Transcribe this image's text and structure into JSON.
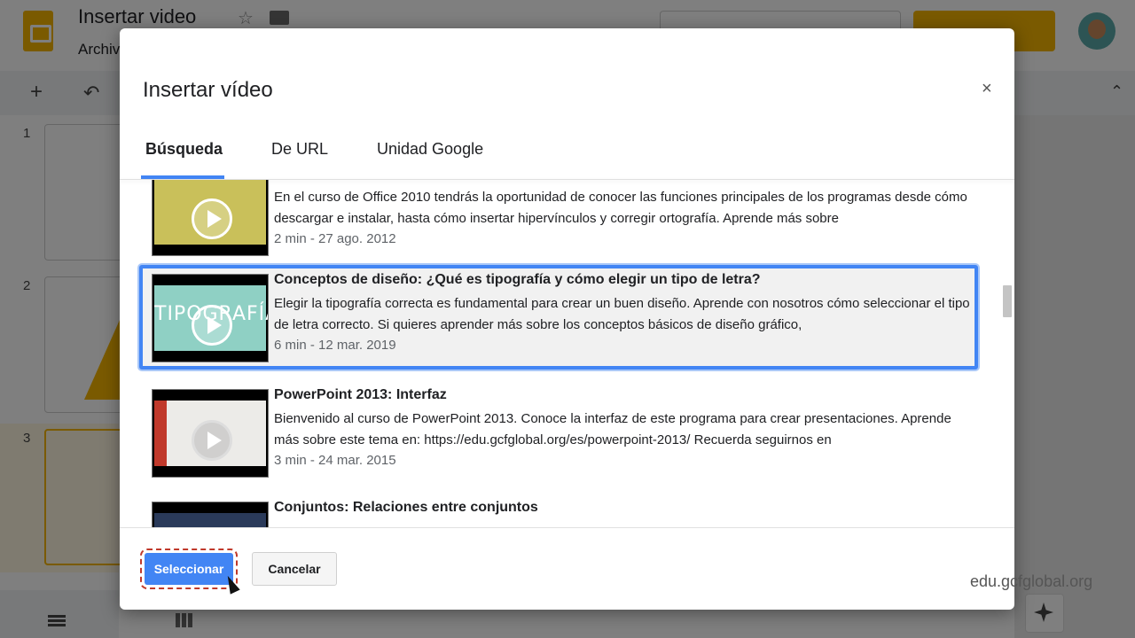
{
  "app": {
    "doc_title": "Insertar video",
    "menu_file": "Archivo",
    "slide_numbers": [
      "1",
      "2",
      "3"
    ]
  },
  "dialog": {
    "title": "Insertar vídeo",
    "close_glyph": "×",
    "tabs": [
      {
        "label": "Búsqueda",
        "active": true
      },
      {
        "label": "De URL",
        "active": false
      },
      {
        "label": "Unidad Google",
        "active": false
      }
    ],
    "results": [
      {
        "title": "",
        "description": "En el curso de Office 2010 tendrás la oportunidad de conocer las funciones principales de los programas desde cómo descargar e instalar, hasta cómo insertar hipervínculos y corregir ortografía. Aprende más sobre",
        "meta": "2 min - 27 ago. 2012",
        "thumb_text": "",
        "thumb_color": "#c9c05a",
        "selected": false
      },
      {
        "title": "Conceptos de diseño: ¿Qué es tipografía y cómo elegir un tipo de letra?",
        "description": "Elegir la tipografía correcta es fundamental para crear un buen diseño. Aprende con nosotros cómo seleccionar el tipo de letra correcto. Si quieres aprender más sobre los conceptos básicos de diseño gráfico,",
        "meta": "6 min - 12 mar. 2019",
        "thumb_text": "TIPOGRAFÍA.",
        "thumb_color": "#8fd0c4",
        "selected": true
      },
      {
        "title": "PowerPoint 2013: Interfaz",
        "description": "Bienvenido al curso de PowerPoint 2013. Conoce la interfaz de este programa para crear presentaciones. Aprende más sobre este tema en: https://edu.gcfglobal.org/es/powerpoint-2013/ Recuerda seguirnos en",
        "meta": "3 min - 24 mar. 2015",
        "thumb_text": "",
        "thumb_color": "#ecebe8",
        "selected": false
      },
      {
        "title": "Conjuntos: Relaciones entre conjuntos",
        "description": "",
        "meta": "",
        "thumb_text": "",
        "thumb_color": "#2a3a5a",
        "selected": false
      }
    ],
    "select_label": "Seleccionar",
    "cancel_label": "Cancelar"
  },
  "watermark": "edu.gcfglobal.org",
  "colors": {
    "accent": "#4285f4",
    "brand": "#f4b400",
    "focus_outline": "#c0392b"
  }
}
